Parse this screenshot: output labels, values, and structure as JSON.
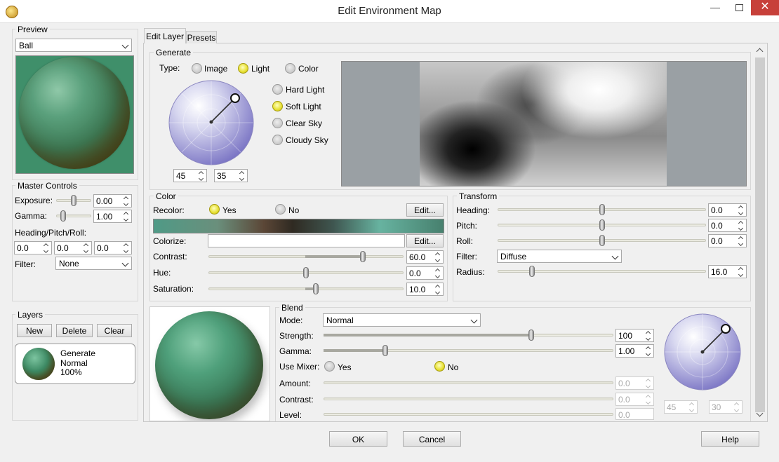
{
  "window": {
    "title": "Edit Environment Map",
    "close_glyph": "✕",
    "min_glyph": "—"
  },
  "colors": {
    "accent_yellow": "#e6df30",
    "sphere_green": "#3c8f6f",
    "selection": "#c7403a"
  },
  "preview": {
    "label": "Preview",
    "mode": "Ball"
  },
  "master": {
    "label": "Master Controls",
    "exposure_label": "Exposure:",
    "exposure_value": "0.00",
    "gamma_label": "Gamma:",
    "gamma_value": "1.00",
    "hpr_label": "Heading/Pitch/Roll:",
    "heading_value": "0.0",
    "pitch_value": "0.0",
    "roll_value": "0.0",
    "filter_label": "Filter:",
    "filter_value": "None"
  },
  "layers": {
    "label": "Layers",
    "new": "New",
    "delete": "Delete",
    "clear": "Clear",
    "items": [
      {
        "name": "Generate",
        "mode": "Normal",
        "opacity": "100%"
      }
    ]
  },
  "tabs": [
    {
      "label": "Edit Layer"
    },
    {
      "label": "Presets"
    }
  ],
  "generate": {
    "label": "Generate",
    "type_label": "Type:",
    "types": [
      "Image",
      "Light",
      "Color"
    ],
    "presets": [
      "Hard Light",
      "Soft Light",
      "Clear Sky",
      "Cloudy Sky"
    ],
    "dir_a": "45",
    "dir_b": "35"
  },
  "color": {
    "label": "Color",
    "recolor_label": "Recolor:",
    "yes": "Yes",
    "no": "No",
    "edit": "Edit...",
    "colorize_label": "Colorize:",
    "colorize_value": "",
    "contrast_label": "Contrast:",
    "contrast_value": "60.0",
    "hue_label": "Hue:",
    "hue_value": "0.0",
    "saturation_label": "Saturation:",
    "saturation_value": "10.0"
  },
  "transform": {
    "label": "Transform",
    "heading_label": "Heading:",
    "heading_value": "0.0",
    "pitch_label": "Pitch:",
    "pitch_value": "0.0",
    "roll_label": "Roll:",
    "roll_value": "0.0",
    "filter_label": "Filter:",
    "filter_value": "Diffuse",
    "radius_label": "Radius:",
    "radius_value": "16.0"
  },
  "blend": {
    "label": "Blend",
    "mode_label": "Mode:",
    "mode_value": "Normal",
    "strength_label": "Strength:",
    "strength_value": "100",
    "gamma_label": "Gamma:",
    "gamma_value": "1.00",
    "mixer_label": "Use Mixer:",
    "yes": "Yes",
    "no": "No",
    "amount_label": "Amount:",
    "amount_value": "0.0",
    "contrast_label": "Contrast:",
    "contrast_value": "0.0",
    "level_label": "Level:",
    "level_value": "0.0",
    "dir_a": "45",
    "dir_b": "30"
  },
  "footer": {
    "ok": "OK",
    "cancel": "Cancel",
    "help": "Help"
  }
}
